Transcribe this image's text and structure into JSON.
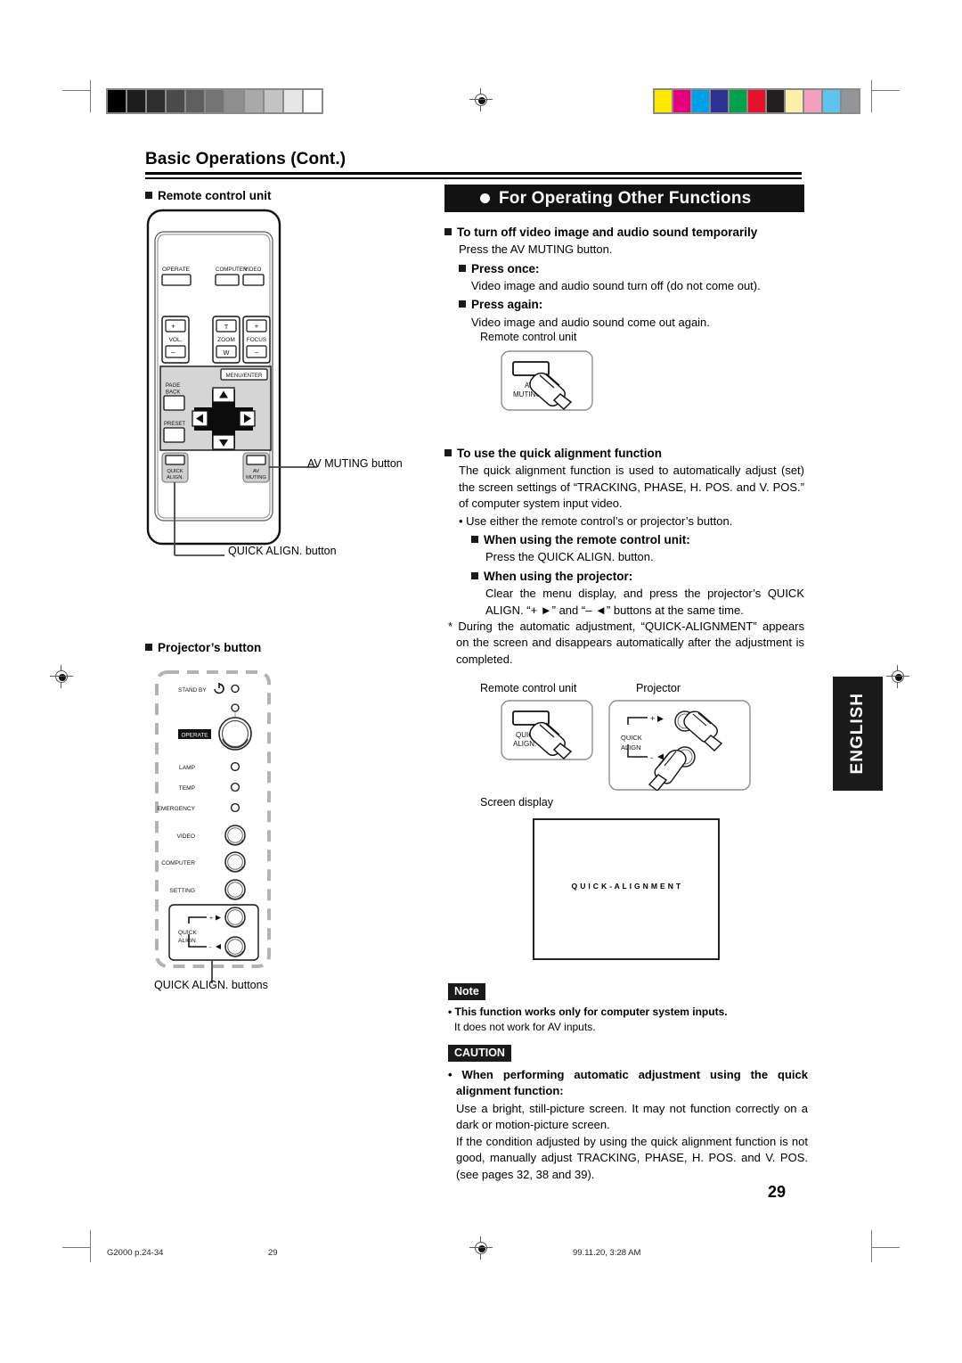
{
  "document": {
    "page_title": "Basic Operations (Cont.)",
    "page_number": "29",
    "language_tab": "ENGLISH"
  },
  "left_column": {
    "remote_heading": "Remote control unit",
    "projector_heading": "Projector’s button",
    "callouts": {
      "av_muting": "AV MUTING button",
      "quick_align": "QUICK ALIGN. button",
      "quick_align_buttons": "QUICK ALIGN. buttons"
    },
    "remote_buttons": {
      "operate": "OPERATE",
      "computer": "COMPUTER",
      "video": "VIDEO",
      "vol": "VOL.",
      "vol_plus": "+",
      "vol_minus": "–",
      "zoom": "ZOOM",
      "zoom_t": "T",
      "zoom_w": "W",
      "focus": "FOCUS",
      "focus_plus": "+",
      "focus_minus": "–",
      "menu_enter": "MENU/ENTER",
      "page_back_l1": "PAGE",
      "page_back_l2": "BACK",
      "preset": "PRESET",
      "quick_align_l1": "QUICK",
      "quick_align_l2": "ALIGN.",
      "av_muting_l1": "AV",
      "av_muting_l2": "MUTING"
    },
    "projector_panel": {
      "stand_by": "STAND BY",
      "operate": "OPERATE",
      "lamp": "LAMP",
      "temp": "TEMP",
      "emergency": "EMERGENCY",
      "video": "VIDEO",
      "computer": "COMPUTER",
      "setting": "SETTING",
      "quick_l1": "QUICK",
      "quick_l2": "ALIGN",
      "plus_mark": "+",
      "minus_mark": "-"
    }
  },
  "right_column": {
    "banner": "For Operating Other Functions",
    "section_mute": {
      "heading": "To turn off video image and audio sound temporarily",
      "intro": "Press the AV MUTING button.",
      "sub1_heading": "Press once:",
      "sub1_text": "Video image and audio sound turn off (do not come out).",
      "sub2_heading": "Press again:",
      "sub2_text": "Video image and audio sound come out again."
    },
    "mute_figure": {
      "caption": "Remote control unit",
      "button_l1": "AV",
      "button_l2": "MUTING"
    },
    "section_quick": {
      "heading": "To use the quick alignment function",
      "p1": "The quick alignment function is used to automatically adjust (set) the screen settings of “TRACKING, PHASE, H. POS. and V. POS.” of computer system input video.",
      "bullet": "• Use either the remote control’s or projector’s button.",
      "sub1_heading": "When using the remote control unit:",
      "sub1_text": "Press the QUICK ALIGN. button.",
      "sub2_heading": "When using the projector:",
      "sub2_text": "Clear the menu display, and press the projector’s QUICK ALIGN. “+ ►” and “– ◄” buttons at the same time.",
      "note_star": "* During the automatic adjustment, “QUICK-ALIGNMENT” appears on the screen and disappears automatically after the adjustment is completed."
    },
    "quick_figure": {
      "caption_remote": "Remote control unit",
      "caption_projector": "Projector",
      "remote_button_l1": "QUICK",
      "remote_button_l2": "ALIGN.",
      "proj_label_l1": "QUICK",
      "proj_label_l2": "ALIGN",
      "proj_plus": "+",
      "proj_minus": "-"
    },
    "screen_figure": {
      "caption": "Screen display",
      "osd_text": "Q U I C K - A L I G N M E N T"
    },
    "note": {
      "badge": "Note",
      "line1": "• This function works only for computer system inputs.",
      "line2": "It does not work for AV inputs."
    },
    "caution": {
      "badge": "CAUTION",
      "heading": "• When performing automatic adjustment using the quick alignment function:",
      "p1": "Use a bright, still-picture screen. It may not function correctly on a dark or motion-picture screen.",
      "p2": "If the condition adjusted by using the quick alignment function is not good, manually adjust TRACKING, PHASE, H. POS. and V. POS. (see pages 32, 38 and 39)."
    }
  },
  "footer": {
    "left": "G2000 p.24-34",
    "center_left": "29",
    "right": "99.11.20, 3:28 AM"
  },
  "calibration": {
    "grayscale": [
      "#000000",
      "#1d1d1d",
      "#2e2e2e",
      "#4b4b4b",
      "#5f5f5f",
      "#747474",
      "#8e8e8e",
      "#a9a9a9",
      "#c3c3c3",
      "#e6e6e6",
      "#ffffff"
    ],
    "colors": [
      "#ffe800",
      "#e6007e",
      "#00a0e9",
      "#2e3192",
      "#00a14b",
      "#e8112d",
      "#231f20",
      "#fbf0a8",
      "#f2a0bd",
      "#5ec3ee",
      "#939598"
    ]
  }
}
